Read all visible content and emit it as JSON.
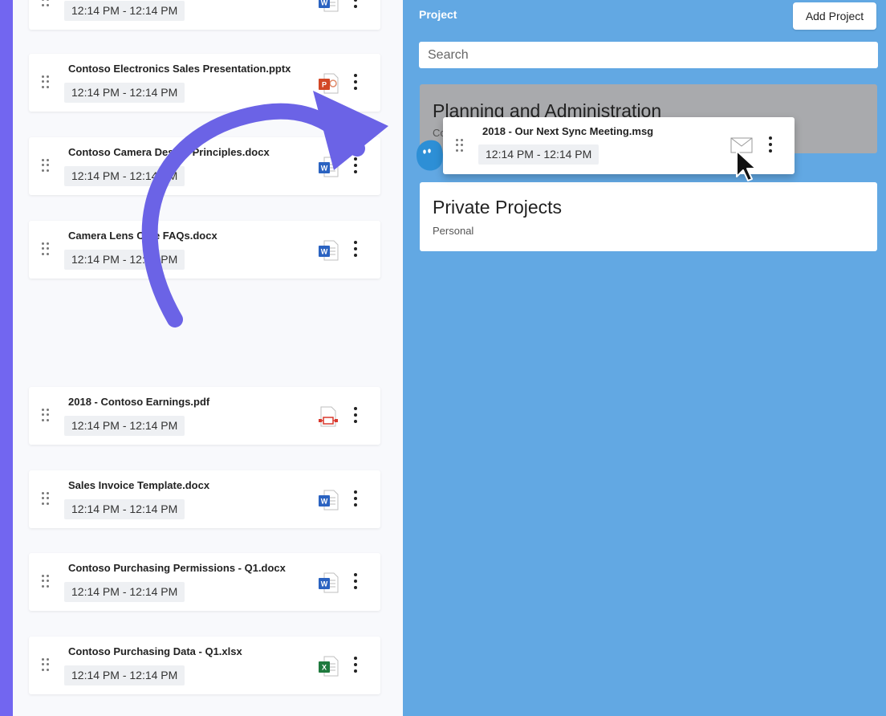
{
  "files": [
    {
      "name": "",
      "time": "12:14 PM  -  12:14 PM",
      "icon": "word-icon"
    },
    {
      "name": "Contoso Electronics Sales Presentation.pptx",
      "time": "12:14 PM  -  12:14 PM",
      "icon": "powerpoint-icon"
    },
    {
      "name": "Contoso Camera Design Principles.docx",
      "time": "12:14 PM  -  12:14 PM",
      "icon": "word-icon"
    },
    {
      "name": "Camera Lens Care FAQs.docx",
      "time": "12:14 PM  -  12:14 PM",
      "icon": "word-icon"
    },
    {
      "name": "2018 - Contoso Earnings.pdf",
      "time": "12:14 PM  -  12:14 PM",
      "icon": "pdf-icon"
    },
    {
      "name": "Sales Invoice Template.docx",
      "time": "12:14 PM  -  12:14 PM",
      "icon": "word-icon"
    },
    {
      "name": "Contoso Purchasing Permissions - Q1.docx",
      "time": "12:14 PM  -  12:14 PM",
      "icon": "word-icon"
    },
    {
      "name": "Contoso Purchasing Data - Q1.xlsx",
      "time": "12:14 PM  -  12:14 PM",
      "icon": "excel-icon"
    }
  ],
  "projects_panel": {
    "title": "Project",
    "add_button": "Add Project",
    "search_placeholder": "Search",
    "projects": [
      {
        "name": "Planning and Administration",
        "subtitle": "Co",
        "highlighted": true
      },
      {
        "name": "Private Projects",
        "subtitle": "Personal",
        "highlighted": false
      }
    ]
  },
  "dragged_item": {
    "name": "2018 - Our Next Sync Meeting.msg",
    "time": "12:14 PM  -  12:14 PM",
    "icon": "email-icon"
  },
  "colors": {
    "frame": "#7266f0",
    "right_panel": "#62a8e3",
    "arrow": "#6b63e6",
    "highlight_card": "#a9aaad"
  }
}
